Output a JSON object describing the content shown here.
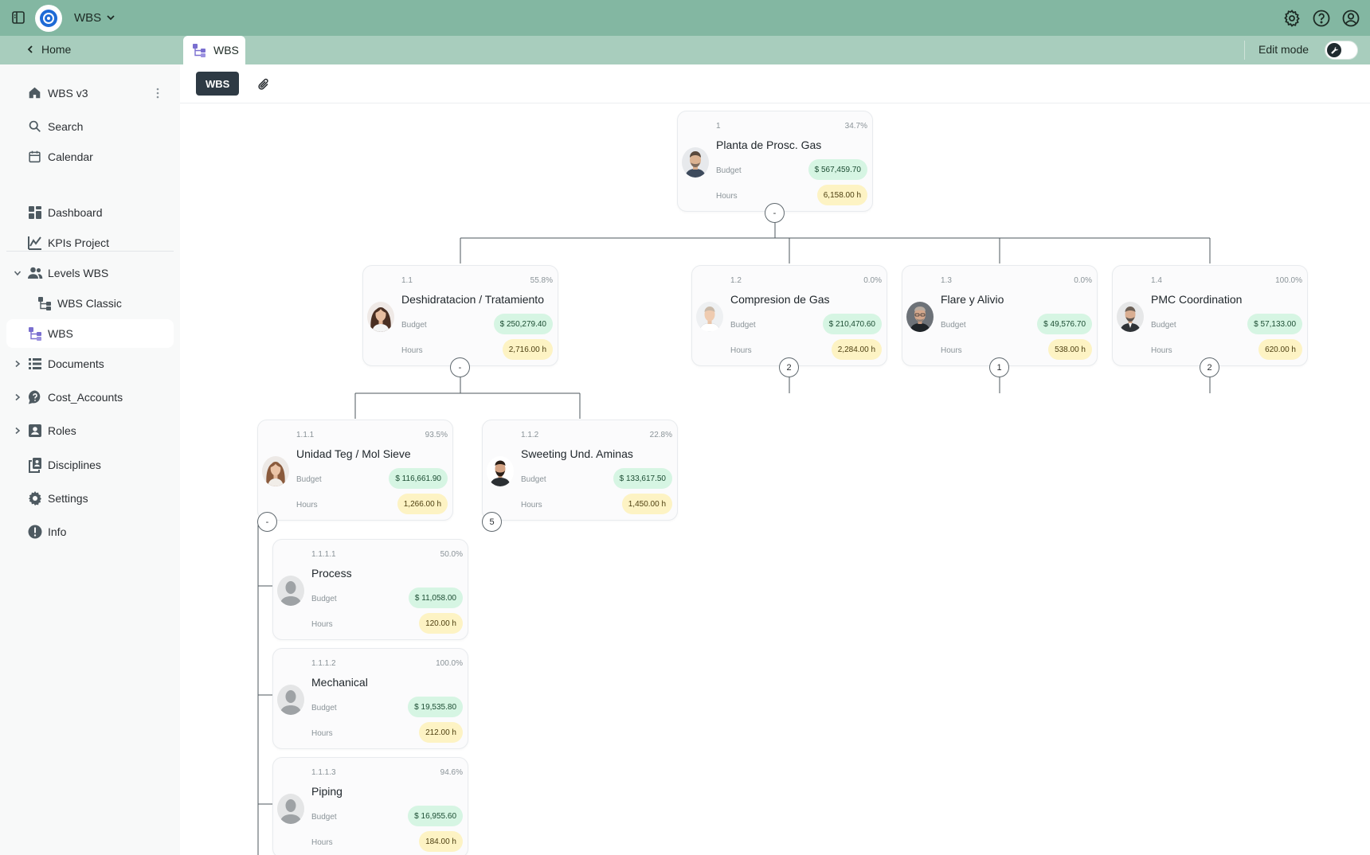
{
  "topbar": {
    "app_name": "WBS",
    "icons": [
      "panel-toggle-icon",
      "app-logo",
      "chevron-down-icon",
      "gear-icon",
      "help-icon",
      "account-icon"
    ]
  },
  "subbar": {
    "home_label": "Home",
    "active_tab": "WBS",
    "edit_mode_label": "Edit mode"
  },
  "sidebar": {
    "workspace": "WBS v3",
    "search": "Search",
    "calendar": "Calendar",
    "items": [
      {
        "label": "Dashboard"
      },
      {
        "label": "KPIs Project"
      },
      {
        "label": "Levels WBS"
      },
      {
        "label": "WBS Classic"
      },
      {
        "label": "WBS"
      },
      {
        "label": "Documents"
      },
      {
        "label": "Cost_Accounts"
      },
      {
        "label": "Roles"
      },
      {
        "label": "Disciplines"
      },
      {
        "label": "Settings"
      },
      {
        "label": "Info"
      }
    ]
  },
  "toolbar": {
    "chip_label": "WBS"
  },
  "colors": {
    "topbar": "#83b7a2",
    "subbar": "#a8cdbd",
    "budget_pill": "#d6f5e3",
    "hours_pill": "#fdf3c4",
    "chip": "#2e3a44"
  },
  "wbs": {
    "root": {
      "code": "1",
      "pct": "34.7%",
      "title": "Planta de Prosc. Gas",
      "budget_label": "Budget",
      "budget": "$ 567,459.70",
      "hours_label": "Hours",
      "hours": "6,158.00 h",
      "toggle": "-"
    },
    "level1": [
      {
        "code": "1.1",
        "pct": "55.8%",
        "title": "Deshidratacion / Tratamiento",
        "budget_label": "Budget",
        "budget": "$ 250,279.40",
        "hours_label": "Hours",
        "hours": "2,716.00 h",
        "toggle": "-"
      },
      {
        "code": "1.2",
        "pct": "0.0%",
        "title": "Compresion de Gas",
        "budget_label": "Budget",
        "budget": "$ 210,470.60",
        "hours_label": "Hours",
        "hours": "2,284.00 h",
        "toggle": "2"
      },
      {
        "code": "1.3",
        "pct": "0.0%",
        "title": "Flare y Alivio",
        "budget_label": "Budget",
        "budget": "$ 49,576.70",
        "hours_label": "Hours",
        "hours": "538.00 h",
        "toggle": "1"
      },
      {
        "code": "1.4",
        "pct": "100.0%",
        "title": "PMC Coordination",
        "budget_label": "Budget",
        "budget": "$ 57,133.00",
        "hours_label": "Hours",
        "hours": "620.00 h",
        "toggle": "2"
      }
    ],
    "level2": [
      {
        "code": "1.1.1",
        "pct": "93.5%",
        "title": "Unidad Teg / Mol Sieve",
        "budget_label": "Budget",
        "budget": "$ 116,661.90",
        "hours_label": "Hours",
        "hours": "1,266.00 h",
        "toggle": "-"
      },
      {
        "code": "1.1.2",
        "pct": "22.8%",
        "title": "Sweeting Und. Aminas",
        "budget_label": "Budget",
        "budget": "$ 133,617.50",
        "hours_label": "Hours",
        "hours": "1,450.00 h",
        "toggle": "5"
      }
    ],
    "level3": [
      {
        "code": "1.1.1.1",
        "pct": "50.0%",
        "title": "Process",
        "budget_label": "Budget",
        "budget": "$ 11,058.00",
        "hours_label": "Hours",
        "hours": "120.00 h"
      },
      {
        "code": "1.1.1.2",
        "pct": "100.0%",
        "title": "Mechanical",
        "budget_label": "Budget",
        "budget": "$ 19,535.80",
        "hours_label": "Hours",
        "hours": "212.00 h"
      },
      {
        "code": "1.1.1.3",
        "pct": "94.6%",
        "title": "Piping",
        "budget_label": "Budget",
        "budget": "$ 16,955.60",
        "hours_label": "Hours",
        "hours": "184.00 h"
      }
    ]
  }
}
